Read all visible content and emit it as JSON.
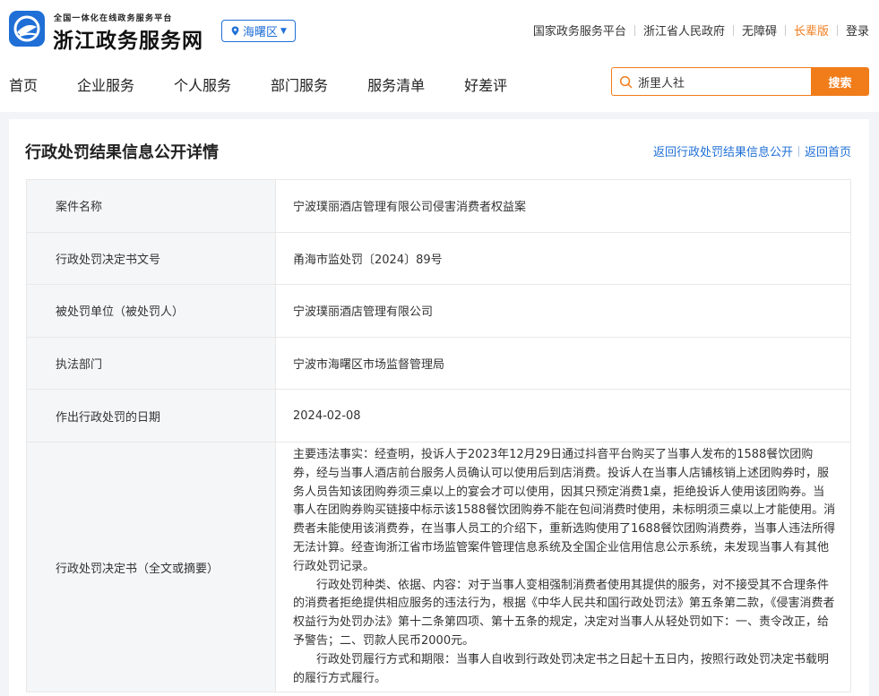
{
  "header": {
    "brand_sub": "全国一体化在线政务服务平台",
    "brand_main": "浙江政务服务网",
    "region": "海曙区",
    "top_links": [
      "国家政务服务平台",
      "浙江省人民政府",
      "无障碍",
      "长辈版",
      "登录"
    ]
  },
  "nav": {
    "items": [
      "首页",
      "企业服务",
      "个人服务",
      "部门服务",
      "服务清单",
      "好差评"
    ]
  },
  "search": {
    "value": "浙里人社",
    "button_label": "搜索"
  },
  "detail": {
    "title": "行政处罚结果信息公开详情",
    "links": [
      "返回行政处罚结果信息公开",
      "返回首页"
    ],
    "rows": [
      {
        "label": "案件名称",
        "value": "宁波璞丽酒店管理有限公司侵害消费者权益案"
      },
      {
        "label": "行政处罚决定书文号",
        "value": "甬海市监处罚〔2024〕89号"
      },
      {
        "label": "被处罚单位（被处罚人）",
        "value": "宁波璞丽酒店管理有限公司"
      },
      {
        "label": "执法部门",
        "value": "宁波市海曙区市场监督管理局"
      },
      {
        "label": "作出行政处罚的日期",
        "value": "2024-02-08"
      }
    ],
    "decision": {
      "label": "行政处罚决定书（全文或摘要）",
      "paragraphs": [
        "主要违法事实：经查明，投诉人于2023年12月29日通过抖音平台购买了当事人发布的1588餐饮团购券，经与当事人酒店前台服务人员确认可以使用后到店消费。投诉人在当事人店铺核销上述团购券时，服务人员告知该团购券须三桌以上的宴会才可以使用，因其只预定消费1桌，拒绝投诉人使用该团购券。当事人在团购券购买链接中标示该1588餐饮团购券不能在包间消费时使用，未标明须三桌以上才能使用。消费者未能使用该消费券，在当事人员工的介绍下，重新选购使用了1688餐饮团购消费券，当事人违法所得无法计算。经查询浙江省市场监管案件管理信息系统及全国企业信用信息公示系统，未发现当事人有其他行政处罚记录。",
        "行政处罚种类、依据、内容：对于当事人变相强制消费者使用其提供的服务，对不接受其不合理条件的消费者拒绝提供相应服务的违法行为，根据《中华人民共和国行政处罚法》第五条第二款，《侵害消费者权益行为处罚办法》第十二条第四项、第十五条的规定，决定对当事人从轻处罚如下：一、责令改正，给予警告；二、罚款人民币2000元。",
        "行政处罚履行方式和期限：当事人自收到行政处罚决定书之日起十五日内，按照行政处罚决定书载明的履行方式履行。"
      ]
    }
  },
  "colors": {
    "brand_blue": "#1f6fd6",
    "accent_orange": "#f07c1a",
    "label_bg": "#f5f6f8"
  },
  "icons": [
    "zhejiang-logo-icon",
    "location-pin-icon",
    "chevron-down-icon",
    "search-icon"
  ]
}
